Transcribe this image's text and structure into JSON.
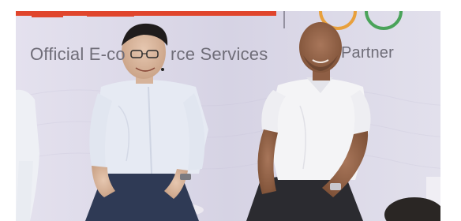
{
  "scene": {
    "banner": {
      "text_left": "Official E-co",
      "text_middle": "rce Services",
      "text_right": "Partner",
      "brand_color": "#e0452c",
      "ring_colors": [
        "#e8a03c",
        "#4aa35a"
      ]
    },
    "people": [
      {
        "name": "person-left-glasses",
        "shirt_color": "#e6eaf3",
        "pants_color": "#2f3a55"
      },
      {
        "name": "person-right-bald",
        "shirt_color": "#f4f4f6",
        "pants_color": "#2b2b30"
      }
    ],
    "backdrop_color": "#d9d6e6"
  }
}
